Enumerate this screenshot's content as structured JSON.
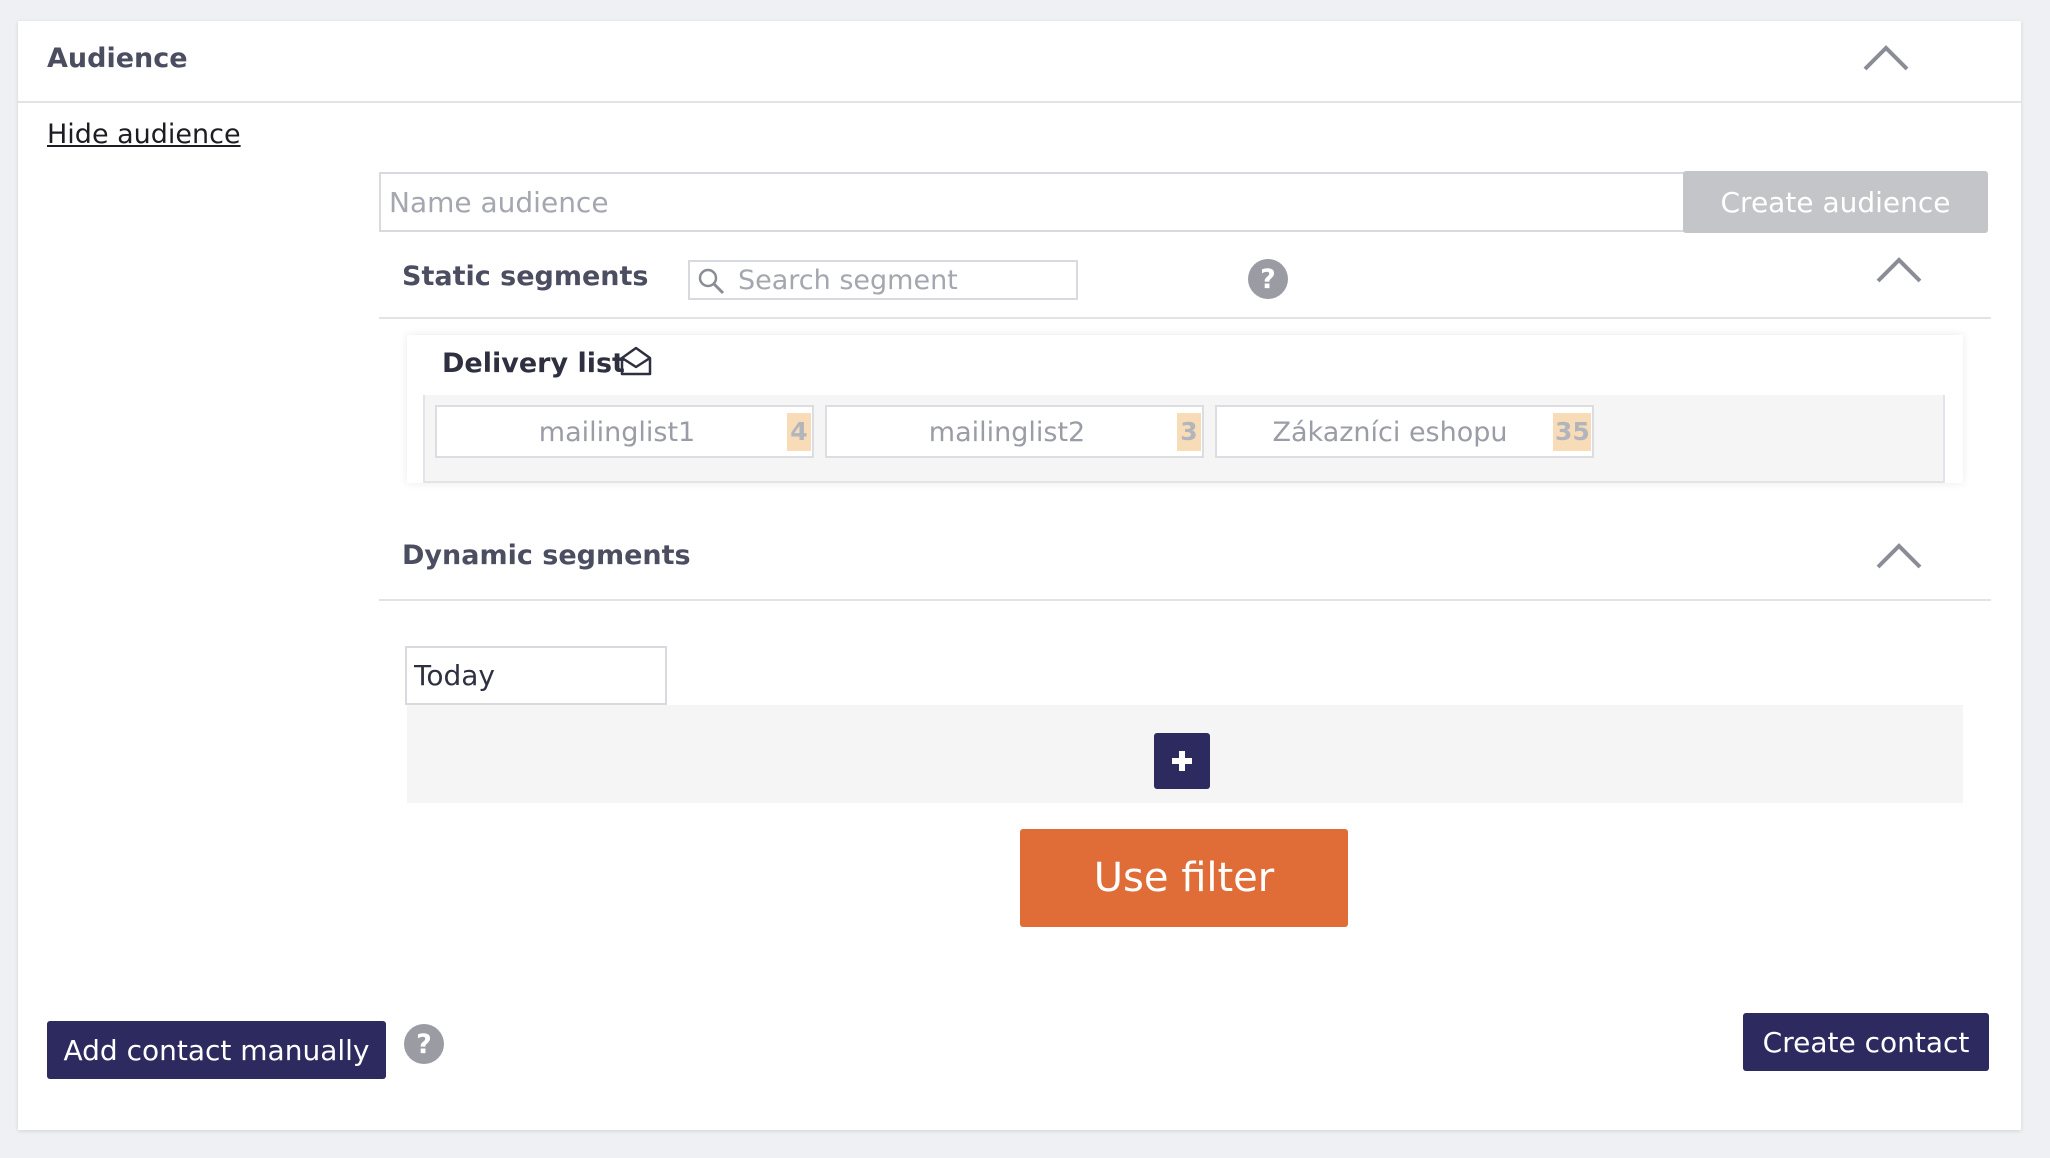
{
  "audience": {
    "title": "Audience",
    "hide_link": "Hide audience",
    "name_placeholder": "Name audience",
    "create_button": "Create audience"
  },
  "static_segments": {
    "title": "Static segments",
    "search_placeholder": "Search segment",
    "delivery_list": {
      "title": "Delivery list",
      "items": [
        {
          "label": "mailinglist1",
          "count": "4"
        },
        {
          "label": "mailinglist2",
          "count": "3"
        },
        {
          "label": "Zákazníci eshopu",
          "count": "35"
        }
      ]
    }
  },
  "dynamic_segments": {
    "title": "Dynamic segments",
    "date_value": "Today",
    "add_icon": "plus-icon",
    "use_filter_button": "Use filter"
  },
  "footer": {
    "add_contact_button": "Add contact manually",
    "create_contact_button": "Create contact"
  },
  "colors": {
    "primary": "#2c2a5e",
    "accent": "#e06c38",
    "disabled": "#c4c5c9",
    "count_badge": "#f8dcb8"
  }
}
